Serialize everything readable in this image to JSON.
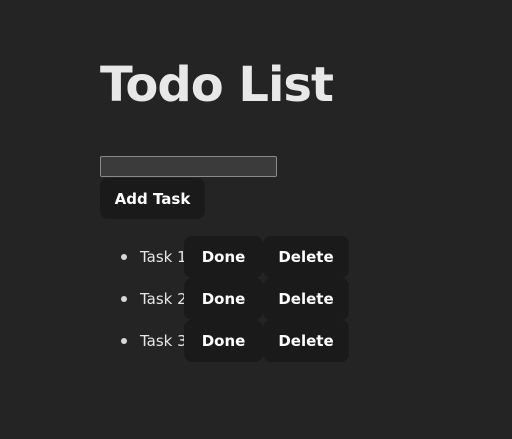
{
  "page": {
    "title": "Todo List"
  },
  "form": {
    "input_value": "",
    "input_placeholder": "",
    "add_label": "Add Task"
  },
  "tasks": [
    {
      "label": "Task 1",
      "done_label": "Done",
      "delete_label": "Delete"
    },
    {
      "label": "Task 2",
      "done_label": "Done",
      "delete_label": "Delete"
    },
    {
      "label": "Task 3",
      "done_label": "Done",
      "delete_label": "Delete"
    }
  ],
  "colors": {
    "background": "#242424",
    "button_bg": "#1a1a1a",
    "text": "#e8e8e8"
  }
}
